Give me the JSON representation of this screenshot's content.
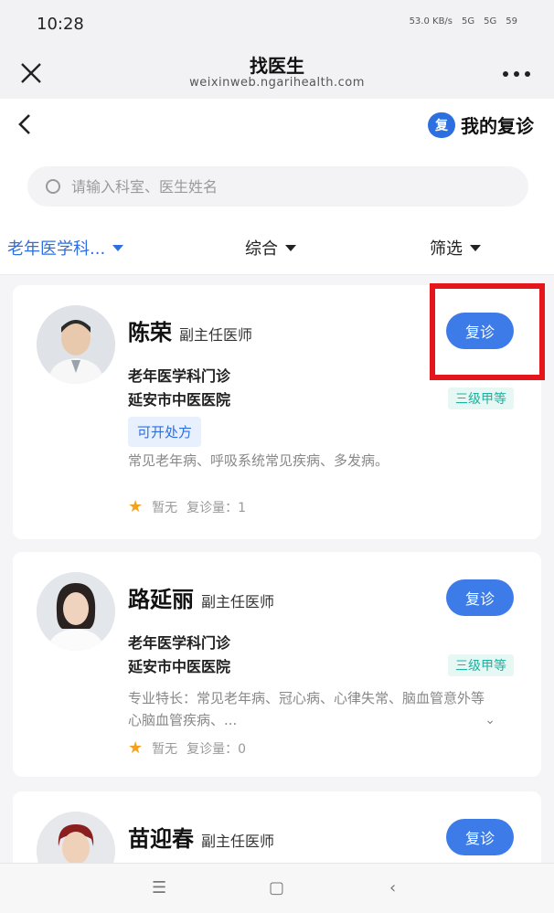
{
  "status_bar": {
    "time": "10:28",
    "net_speed": "53.0 KB/s",
    "signal1": "5G",
    "signal2": "5G",
    "battery": "59"
  },
  "title_bar": {
    "title": "找医生",
    "subtitle": "weixinweb.ngarihealth.com"
  },
  "nav": {
    "my_revisit_badge": "复",
    "my_revisit_label": "我的复诊"
  },
  "search": {
    "placeholder": "请输入科室、医生姓名"
  },
  "filters": {
    "department": "老年医学科...",
    "sort": "综合",
    "screen": "筛选"
  },
  "doctors": [
    {
      "name": "陈荣",
      "title": "副主任医师",
      "button": "复诊",
      "department": "老年医学科门诊",
      "hospital": "延安市中医医院",
      "grade": "三级甲等",
      "tag": "可开处方",
      "specialty": "常见老年病、呼吸系统常见疾病、多发病。",
      "rating": "暂无",
      "revisit_count": "复诊量：1"
    },
    {
      "name": "路延丽",
      "title": "副主任医师",
      "button": "复诊",
      "department": "老年医学科门诊",
      "hospital": "延安市中医医院",
      "grade": "三级甲等",
      "specialty": "专业特长：常见老年病、冠心病、心律失常、脑血管意外等心脑血管疾病、...",
      "rating": "暂无",
      "revisit_count": "复诊量：0"
    },
    {
      "name": "苗迎春",
      "title": "副主任医师",
      "button": "复诊"
    }
  ],
  "colors": {
    "accent": "#2d6fe0",
    "button": "#3d7ce8",
    "highlight": "#e4161b",
    "grade": "#1bb3a0",
    "star": "#f4a21e"
  }
}
